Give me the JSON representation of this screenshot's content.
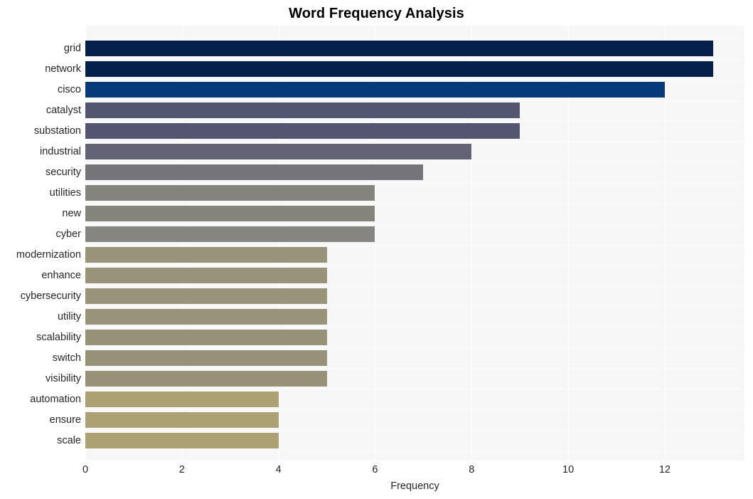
{
  "chart_data": {
    "type": "bar",
    "orientation": "horizontal",
    "title": "Word Frequency Analysis",
    "xlabel": "Frequency",
    "ylabel": "",
    "categories": [
      "grid",
      "network",
      "cisco",
      "catalyst",
      "substation",
      "industrial",
      "security",
      "utilities",
      "new",
      "cyber",
      "modernization",
      "enhance",
      "cybersecurity",
      "utility",
      "scalability",
      "switch",
      "visibility",
      "automation",
      "ensure",
      "scale"
    ],
    "values": [
      13,
      13,
      12,
      9,
      9,
      8,
      7,
      6,
      6,
      6,
      5,
      5,
      5,
      5,
      5,
      5,
      5,
      4,
      4,
      4
    ],
    "xlim": [
      0,
      13.65
    ],
    "ylim_categories": 20,
    "xticks": [
      0,
      2,
      4,
      6,
      8,
      10,
      12
    ],
    "xticklabels": [
      "0",
      "2",
      "4",
      "6",
      "8",
      "10",
      "12"
    ],
    "grid": true,
    "grid_axis": "both",
    "grid_color": "#ffffff",
    "legend": false,
    "plot_background": "#f7f7f7",
    "figure_background": "#ffffff",
    "bar_colors": [
      "#05204a",
      "#05204a",
      "#073a78",
      "#52566f",
      "#53566e",
      "#626374",
      "#75747a",
      "#85847b",
      "#85847b",
      "#868580",
      "#989379",
      "#989379",
      "#989379",
      "#989379",
      "#969177",
      "#969177",
      "#969177",
      "#aca173",
      "#aca173",
      "#aca173"
    ]
  }
}
